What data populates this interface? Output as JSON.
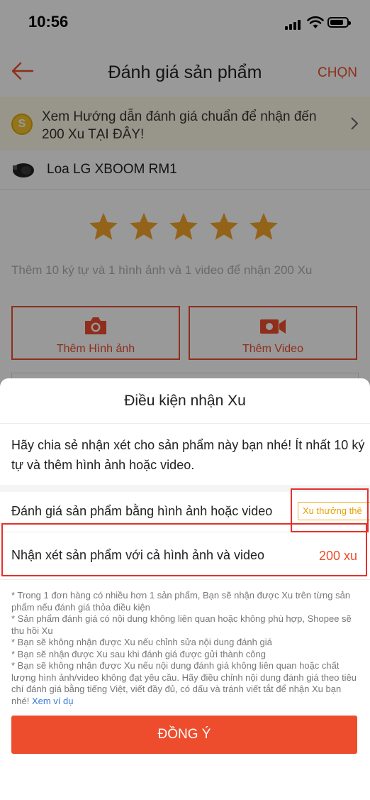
{
  "status_bar": {
    "time": "10:56"
  },
  "nav": {
    "title": "Đánh giá sản phẩm",
    "action": "CHỌN"
  },
  "banner": {
    "text": "Xem Hướng dẫn đánh giá chuẩn để nhận đến 200 Xu TẠI ĐÂY!",
    "coin_glyph": "S"
  },
  "product": {
    "name": "Loa LG XBOOM RM1"
  },
  "rating": {
    "stars": 5,
    "max_stars": 5,
    "star_color": "#f4a62a",
    "hint": "Thêm 10 ký tự và 1 hình ảnh và 1 video để nhận 200 Xu",
    "add_photo_label": "Thêm Hình ảnh",
    "add_video_label": "Thêm Video"
  },
  "sheet": {
    "title": "Điều kiện nhận Xu",
    "description": "Hãy chia sẻ nhận xét cho sản phẩm này bạn nhé! Ít nhất 10 ký tự và thêm hình ảnh hoặc video.",
    "conditions": [
      {
        "label": "Đánh giá sản phẩm bằng hình ảnh hoặc video",
        "value": "Xu thưởng thê"
      },
      {
        "label": "Nhận xét sản phẩm với cả hình ảnh và video",
        "value": "200 xu"
      }
    ],
    "notes": [
      "* Trong 1 đơn hàng có nhiều hơn 1 sản phẩm, Bạn sẽ nhận được Xu trên từng sản phẩm nếu đánh giá thỏa điều kiện",
      "* Sản phẩm đánh giá có nội dung không liên quan hoặc không phù hợp, Shopee sẽ thu hồi Xu",
      "* Bạn sẽ không nhận được Xu nếu chỉnh sửa nội dung đánh giá",
      "* Bạn sẽ nhận được Xu sau khi đánh giá được gửi thành công",
      "* Bạn sẽ không nhận được Xu nếu nội dung đánh giá không liên quan hoặc chất lượng hình ảnh/video không đạt yêu cầu. Hãy điều chỉnh nội dung đánh giá theo tiêu chí đánh giá bằng tiếng Việt, viết đầy đủ, có dấu và tránh viết tắt để nhận Xu bạn nhé!"
    ],
    "example_link": "Xem ví dụ",
    "confirm_label": "ĐỒNG Ý"
  },
  "colors": {
    "brand": "#ee4d2d",
    "highlight": "#e5312a",
    "coin": "#f4c430"
  }
}
